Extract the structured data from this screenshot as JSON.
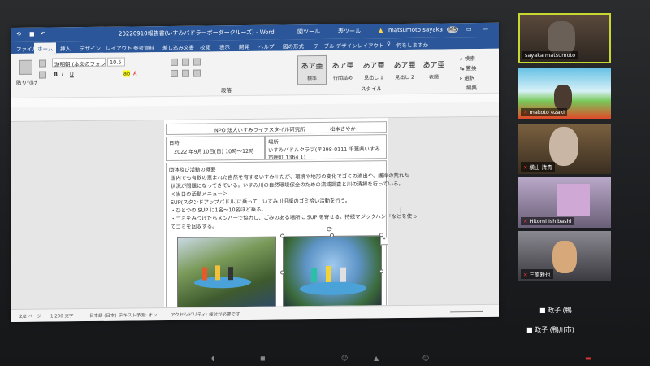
{
  "word": {
    "title": "20220910報告書(いすみパドラーボーダークルーズ) - Word",
    "context_tab_1": "図ツール",
    "context_tab_2": "表ツール",
    "user_name": "matsumoto sayaka",
    "user_initials": "MS",
    "tabs": [
      "ファイル",
      "ホーム",
      "挿入",
      "デザイン",
      "レイアウト",
      "参考資料",
      "差し込み文書",
      "校閲",
      "表示",
      "開発",
      "ヘルプ",
      "図の形式",
      "テーブル デザイン",
      "レイアウト"
    ],
    "tell_me": "何をしますか",
    "ribbon": {
      "paste": "貼り付け",
      "font_name": "游明朝 (本文のフォント)",
      "font_size": "10.5",
      "paragraph_label": "段落",
      "style_label": "スタイル",
      "edit_label": "編集",
      "styles": [
        {
          "sample": "あア亜",
          "name": "標準"
        },
        {
          "sample": "あア亜",
          "name": "行間詰め"
        },
        {
          "sample": "あア亜",
          "name": "見出し 1"
        },
        {
          "sample": "あア亜",
          "name": "見出し 2"
        },
        {
          "sample": "あア亜",
          "name": "表題"
        }
      ],
      "edit_items": [
        "検索",
        "置換",
        "選択"
      ]
    },
    "document": {
      "top_org": "NPO 法人いすみライフスタイル研究所",
      "top_person": "松本さやか",
      "date_label": "日時",
      "date_value": "2022 年9月10日(日) 10時～12時",
      "place_label": "場所",
      "place_value": "いすみパドルクラブ(〒298-0111 千葉県いすみ市岬町 1364 1)",
      "summary_label": "団体及び活動の概要",
      "line1": "国内でも有数の恵まれた自然を有するいすみ川だが、環境や地形の変化でゴミの流出や、護岸の荒れた",
      "line2": "状況が問題になってきている。いすみ川の自然環境保全のための流域調査と川の清掃を行っている。",
      "line3": "＜当日の活動メニュー＞",
      "line4": "SUP(スタンドアップパドル)に乗って、いすみ川沿岸のゴミ拾い活動を行う。",
      "line5": "・ひとつの SUP に1名～10名ほど乗る。",
      "line6": "・ゴミをみつけたらメンバーで協力し、ごみのある場所に SUP を寄せる。持続マジックハンドなどを使っ",
      "line7": "てゴミを回収する。"
    },
    "status": {
      "page": "2/2 ページ",
      "words": "1,200 文字",
      "lang": "日本語 (日本)",
      "predict": "テキスト予測: オン",
      "accessibility": "アクセシビリティ: 検討が必要です"
    }
  },
  "zoom": {
    "participants": [
      {
        "name": "sayaka matsumoto"
      },
      {
        "name": "makoto ezaki"
      },
      {
        "name": "横山 清貴"
      },
      {
        "name": "Hitomi Ishibashi"
      },
      {
        "name": "三原雅也"
      }
    ],
    "extra_1": "■ 政子 (鴨...",
    "extra_2": "■ 政子 (鴨川市)"
  }
}
